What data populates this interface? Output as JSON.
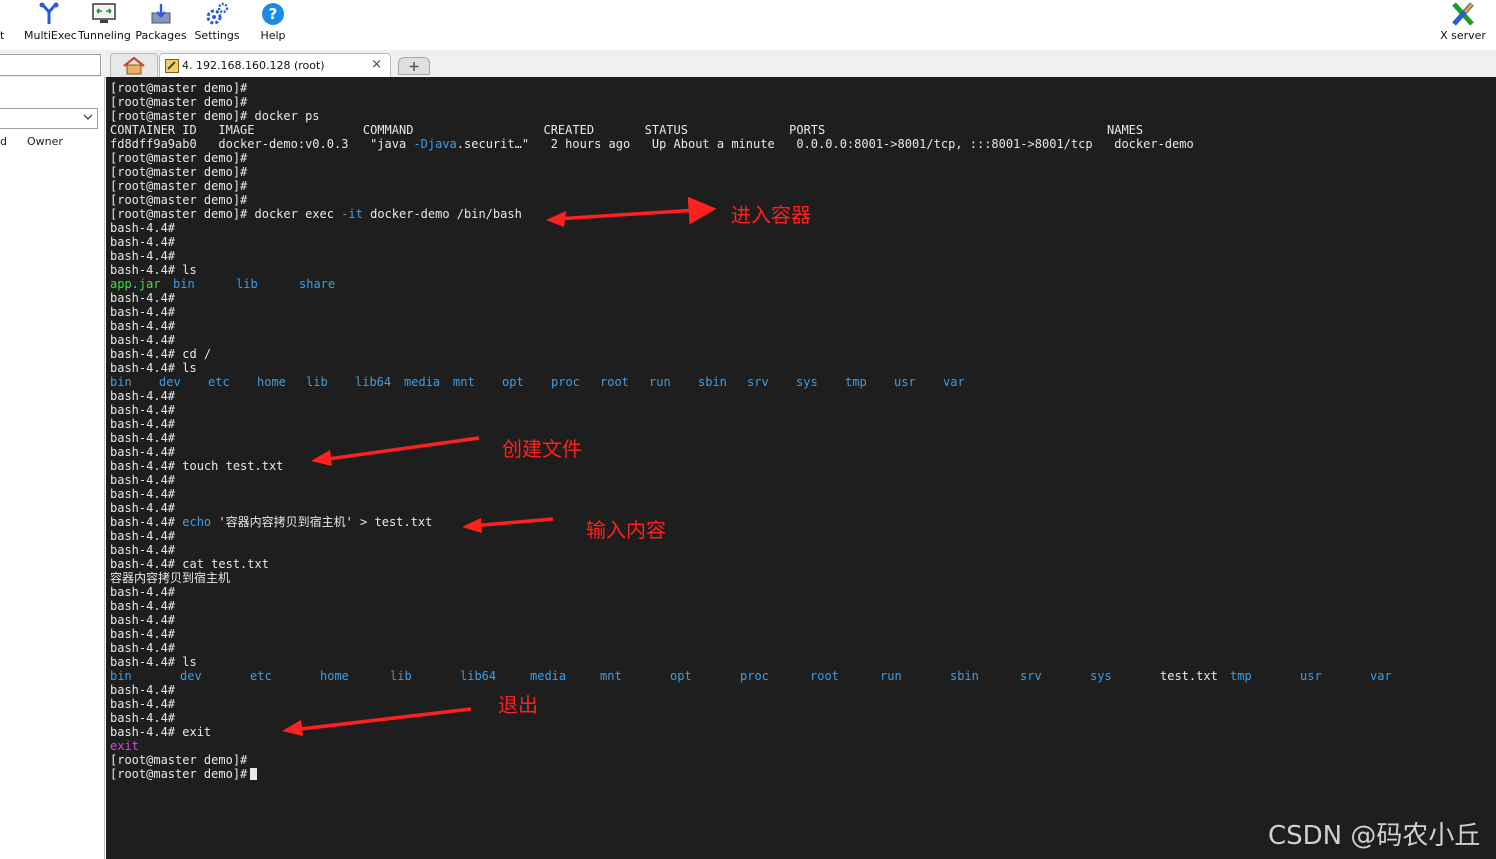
{
  "toolbar": {
    "partial_label": "t",
    "items": [
      {
        "label": "MultiExec",
        "icon": "multiexec-icon"
      },
      {
        "label": "Tunneling",
        "icon": "tunneling-icon"
      },
      {
        "label": "Packages",
        "icon": "packages-icon"
      },
      {
        "label": "Settings",
        "icon": "settings-icon"
      },
      {
        "label": "Help",
        "icon": "help-icon"
      }
    ],
    "xserver_label": "X server"
  },
  "tabs": {
    "session_label": "4. 192.168.160.128 (root)",
    "close_glyph": "×"
  },
  "sidebar": {
    "col_left": "d",
    "col_owner": "Owner"
  },
  "terminal": {
    "lines": [
      "[root@master demo]#",
      "[root@master demo]#",
      "[root@master demo]# docker ps",
      "CONTAINER ID   IMAGE               COMMAND                  CREATED       STATUS              PORTS                                       NAMES",
      "fd8dff9a9ab0   docker-demo:v0.0.3   \"java -Djava.securit…\"   2 hours ago   Up About a minute   0.0.0.0:8001->8001/tcp, :::8001->8001/tcp   docker-demo",
      "[root@master demo]#",
      "[root@master demo]#",
      "[root@master demo]#",
      "[root@master demo]#",
      "[root@master demo]# docker exec -it docker-demo /bin/bash",
      "bash-4.4#",
      "bash-4.4#",
      "bash-4.4#",
      "bash-4.4# ls",
      "",
      "bash-4.4#",
      "bash-4.4#",
      "bash-4.4#",
      "bash-4.4#",
      "bash-4.4# cd /",
      "bash-4.4# ls",
      "",
      "bash-4.4#",
      "bash-4.4#",
      "bash-4.4#",
      "bash-4.4#",
      "bash-4.4#",
      "bash-4.4# touch test.txt",
      "bash-4.4#",
      "bash-4.4#",
      "bash-4.4#",
      "bash-4.4# echo '容器内容拷贝到宿主机' > test.txt",
      "bash-4.4#",
      "bash-4.4#",
      "bash-4.4# cat test.txt",
      "容器内容拷贝到宿主机",
      "bash-4.4#",
      "bash-4.4#",
      "bash-4.4#",
      "bash-4.4#",
      "bash-4.4#",
      "bash-4.4# ls",
      "",
      "bash-4.4#",
      "bash-4.4#",
      "bash-4.4#",
      "bash-4.4# exit",
      "exit",
      "[root@master demo]#",
      "[root@master demo]#"
    ],
    "ls_app": [
      "app.jar",
      "bin",
      "lib",
      "share"
    ],
    "ls_root1": [
      "bin",
      "dev",
      "etc",
      "home",
      "lib",
      "lib64",
      "media",
      "mnt",
      "opt",
      "proc",
      "root",
      "run",
      "sbin",
      "srv",
      "sys",
      "tmp",
      "usr",
      "var"
    ],
    "ls_root2": [
      "bin",
      "dev",
      "etc",
      "home",
      "lib",
      "lib64",
      "media",
      "mnt",
      "opt",
      "proc",
      "root",
      "run",
      "sbin",
      "srv",
      "sys",
      "test.txt",
      "tmp",
      "usr",
      "var"
    ]
  },
  "annotations": {
    "enter_container": "进入容器",
    "create_file": "创建文件",
    "input_content": "输入内容",
    "exit": "退出"
  },
  "watermark": "CSDN @码农小丘",
  "colors": {
    "terminal_bg": "#1e1e1e",
    "terminal_fg": "#e8e8e8",
    "dir_blue": "#3b9ee8",
    "file_green": "#49d849",
    "exit_magenta": "#e040e0",
    "annotation_red": "#ff2020"
  }
}
